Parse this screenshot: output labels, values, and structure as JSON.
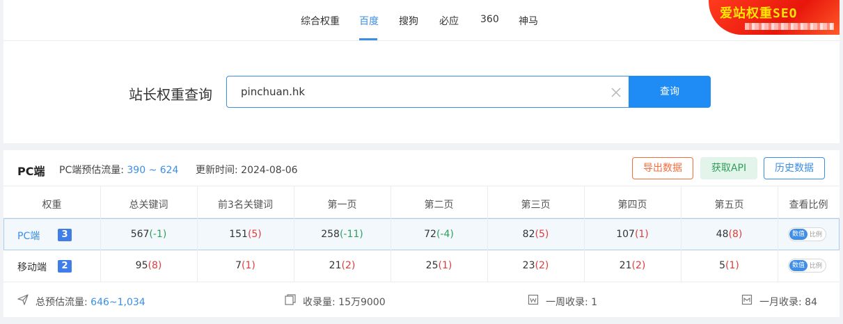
{
  "nav": {
    "tabs": [
      {
        "label": "综合权重"
      },
      {
        "label": "百度"
      },
      {
        "label": "搜狗"
      },
      {
        "label": "必应"
      },
      {
        "label": "360"
      },
      {
        "label": "神马"
      }
    ],
    "active_tab": "百度",
    "logo_text": "爱站权重SEO"
  },
  "search": {
    "title": "站长权重查询",
    "value": "pinchuan.hk",
    "button_label": "查询"
  },
  "result": {
    "title": "PC端",
    "traffic_label": "PC端预估流量:",
    "traffic_value": "390 ~ 624",
    "update_label": "更新时间:",
    "update_value": "2024-08-06",
    "buttons": {
      "export": "导出数据",
      "api": "获取API",
      "history": "历史数据"
    },
    "columns": [
      "权重",
      "总关键词",
      "前3名关键词",
      "第一页",
      "第二页",
      "第三页",
      "第四页",
      "第五页",
      "查看比例"
    ],
    "rows": [
      {
        "label": "PC端",
        "rank": "3",
        "cells": [
          {
            "base": "567",
            "delta": "(-1)"
          },
          {
            "base": "151",
            "delta": "(5)"
          },
          {
            "base": "258",
            "delta": "(-11)"
          },
          {
            "base": "72",
            "delta": "(-4)"
          },
          {
            "base": "82",
            "delta": "(5)"
          },
          {
            "base": "107",
            "delta": "(1)"
          },
          {
            "base": "48",
            "delta": "(8)"
          }
        ],
        "toggle_on": "数值",
        "toggle_off": "比例"
      },
      {
        "label": "移动端",
        "rank": "2",
        "cells": [
          {
            "base": "95",
            "delta": "(8)"
          },
          {
            "base": "7",
            "delta": "(1)"
          },
          {
            "base": "21",
            "delta": "(2)"
          },
          {
            "base": "25",
            "delta": "(1)"
          },
          {
            "base": "23",
            "delta": "(2)"
          },
          {
            "base": "21",
            "delta": "(2)"
          },
          {
            "base": "5",
            "delta": "(1)"
          }
        ],
        "toggle_on": "数值",
        "toggle_off": "比例"
      }
    ],
    "footer": {
      "total_traffic_label": "总预估流量:",
      "total_traffic_value": "646~1,034",
      "indexed_label": "收录量:",
      "indexed_value": "15万9000",
      "week_label": "一周收录:",
      "week_value": "1",
      "month_label": "一月收录:",
      "month_value": "84"
    }
  },
  "colors": {
    "accent": "#3a8ee6",
    "negative_delta": "#2f9e5a",
    "positive_delta": "#e23b3b"
  }
}
